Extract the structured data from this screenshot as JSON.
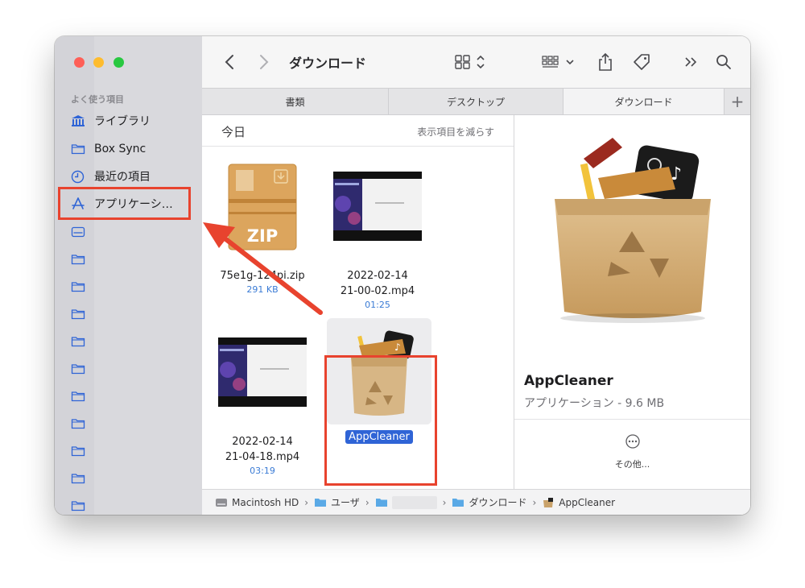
{
  "sidebar": {
    "section_title": "よく使う項目",
    "items": [
      {
        "label": "ライブラリ",
        "icon": "building-columns-icon"
      },
      {
        "label": "Box Sync",
        "icon": "folder-icon"
      },
      {
        "label": "最近の項目",
        "icon": "clock-icon"
      },
      {
        "label": "アプリケーシ…",
        "icon": "app-store-icon"
      }
    ]
  },
  "toolbar": {
    "title": "ダウンロード"
  },
  "tabs": [
    {
      "label": "書類"
    },
    {
      "label": "デスクトップ"
    },
    {
      "label": "ダウンロード"
    }
  ],
  "content": {
    "group_title": "今日",
    "group_action": "表示項目を減らす",
    "files": [
      {
        "name": "75e1g-124pi.zip",
        "meta": "291 KB"
      },
      {
        "name_line1": "2022-02-14",
        "name_line2": "21-00-02.mp4",
        "meta": "01:25"
      },
      {
        "name_line1": "2022-02-14",
        "name_line2": "21-04-18.mp4",
        "meta": "03:19"
      },
      {
        "name": "AppCleaner",
        "selected": true
      }
    ],
    "zip_label": "ZIP"
  },
  "preview": {
    "name": "AppCleaner",
    "meta": "アプリケーション - 9.6 MB",
    "more_label": "その他..."
  },
  "pathbar": {
    "crumbs": [
      "Macintosh HD",
      "ユーザ",
      "",
      "ダウンロード",
      "AppCleaner"
    ]
  },
  "colors": {
    "highlight": "#e8432e",
    "selection": "#2f64d6",
    "accent": "#3a7bd5"
  }
}
